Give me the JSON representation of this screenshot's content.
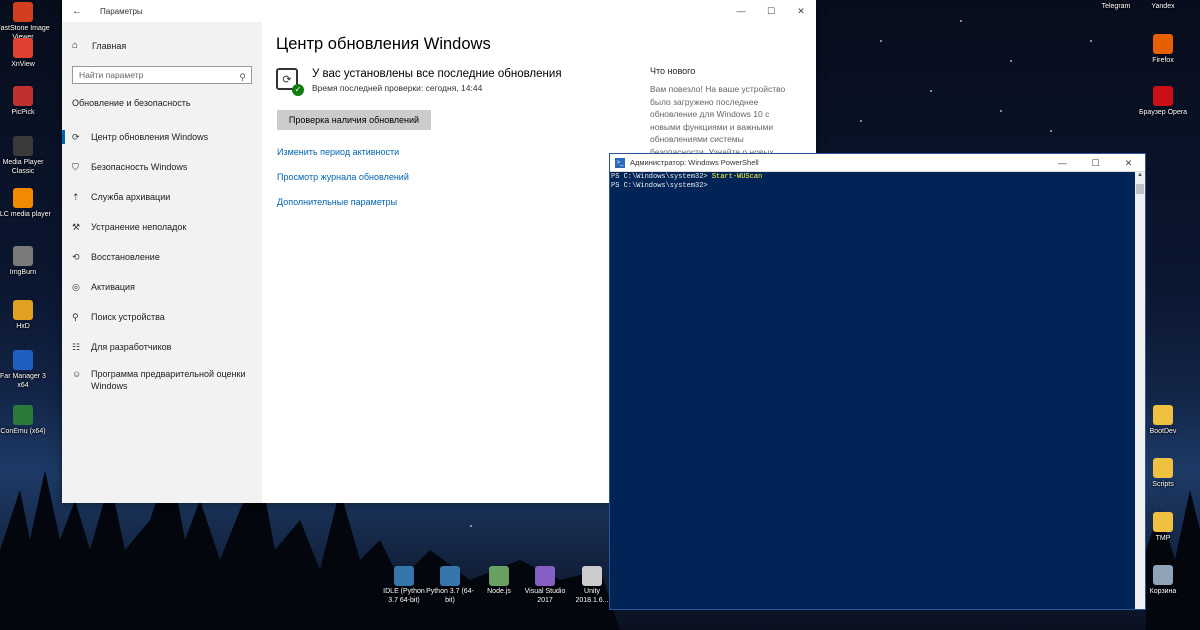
{
  "desktop": {
    "left_icons": [
      {
        "label": "FastStone Image Viewer",
        "icon": "faststone-icon",
        "color": "#d23f1f"
      },
      {
        "label": "XnView",
        "icon": "xnview-icon",
        "color": "#e04030"
      },
      {
        "label": "PicPick",
        "icon": "picpick-icon",
        "color": "#c0302f"
      },
      {
        "label": "Media Player Classic",
        "icon": "mpc-icon",
        "color": "#3a3a3a"
      },
      {
        "label": "VLC media player",
        "icon": "vlc-icon",
        "color": "#f28a00"
      },
      {
        "label": "ImgBurn",
        "icon": "imgburn-icon",
        "color": "#7a7a7a"
      },
      {
        "label": "HxD",
        "icon": "hxd-icon",
        "color": "#e0a020"
      },
      {
        "label": "Far Manager 3 x64",
        "icon": "far-manager-icon",
        "color": "#1f5fbf"
      },
      {
        "label": "ConEmu (x64)",
        "icon": "conemu-icon",
        "color": "#2a7a3a"
      }
    ],
    "right_icons": [
      {
        "label": "Telegram",
        "icon": "telegram-icon",
        "color": "#2ca5e0"
      },
      {
        "label": "Yandex",
        "icon": "yandex-icon",
        "color": "#e52620"
      },
      {
        "label": "Firefox",
        "icon": "firefox-icon",
        "color": "#e66000"
      },
      {
        "label": "Браузер Opera",
        "icon": "opera-icon",
        "color": "#cc0f16"
      },
      {
        "label": "BootDev",
        "icon": "folder-icon",
        "color": "#f0c040"
      },
      {
        "label": "Scripts",
        "icon": "folder-icon",
        "color": "#f0c040"
      },
      {
        "label": "TMP",
        "icon": "folder-icon",
        "color": "#f0c040"
      },
      {
        "label": "Корзина",
        "icon": "recycle-bin-icon",
        "color": "#8fa3b8"
      }
    ],
    "bottom_icons": [
      {
        "label": "IDLE (Python 3.7 64-bit)",
        "icon": "python-idle-icon",
        "color": "#3776ab"
      },
      {
        "label": "Python 3.7 (64-bit)",
        "icon": "python-icon",
        "color": "#3776ab"
      },
      {
        "label": "Node.js",
        "icon": "nodejs-icon",
        "color": "#68a063"
      },
      {
        "label": "Visual Studio 2017",
        "icon": "visual-studio-icon",
        "color": "#865fc5"
      },
      {
        "label": "Unity 2018.1.6...",
        "icon": "unity-icon",
        "color": "#cccccc"
      }
    ]
  },
  "settings": {
    "window_title": "Параметры",
    "home_label": "Главная",
    "search_placeholder": "Найти параметр",
    "section_title": "Обновление и безопасность",
    "nav": [
      {
        "label": "Центр обновления Windows",
        "icon": "sync-icon",
        "glyph": "⟳",
        "active": true
      },
      {
        "label": "Безопасность Windows",
        "icon": "shield-icon",
        "glyph": "⛉"
      },
      {
        "label": "Служба архивации",
        "icon": "backup-icon",
        "glyph": "⇡"
      },
      {
        "label": "Устранение неполадок",
        "icon": "wrench-icon",
        "glyph": "⚒"
      },
      {
        "label": "Восстановление",
        "icon": "recovery-icon",
        "glyph": "⟲"
      },
      {
        "label": "Активация",
        "icon": "activation-icon",
        "glyph": "◎"
      },
      {
        "label": "Поиск устройства",
        "icon": "find-device-icon",
        "glyph": "⚲"
      },
      {
        "label": "Для разработчиков",
        "icon": "developer-icon",
        "glyph": "☷"
      },
      {
        "label": "Программа предварительной оценки Windows",
        "icon": "insider-icon",
        "glyph": "☺"
      }
    ],
    "main": {
      "heading": "Центр обновления Windows",
      "status_title": "У вас установлены все последние обновления",
      "status_sub": "Время последней проверки: сегодня, 14:44",
      "check_button": "Проверка наличия обновлений",
      "links": [
        "Изменить период активности",
        "Просмотр журнала обновлений",
        "Дополнительные параметры"
      ],
      "news_title": "Что нового",
      "news_text": "Вам повезло! На ваше устройство было загружено последнее обновление для Windows 10 с новыми функциями и важными обновлениями системы безопасности. Узнайте о новых"
    }
  },
  "powershell": {
    "window_title": "Администратор: Windows PowerShell",
    "lines": [
      {
        "prompt": "PS C:\\Windows\\system32> ",
        "command": "Start-WUScan"
      },
      {
        "prompt": "PS C:\\Windows\\system32> ",
        "command": ""
      }
    ],
    "background": "#012456",
    "command_color": "#ffff3c"
  }
}
